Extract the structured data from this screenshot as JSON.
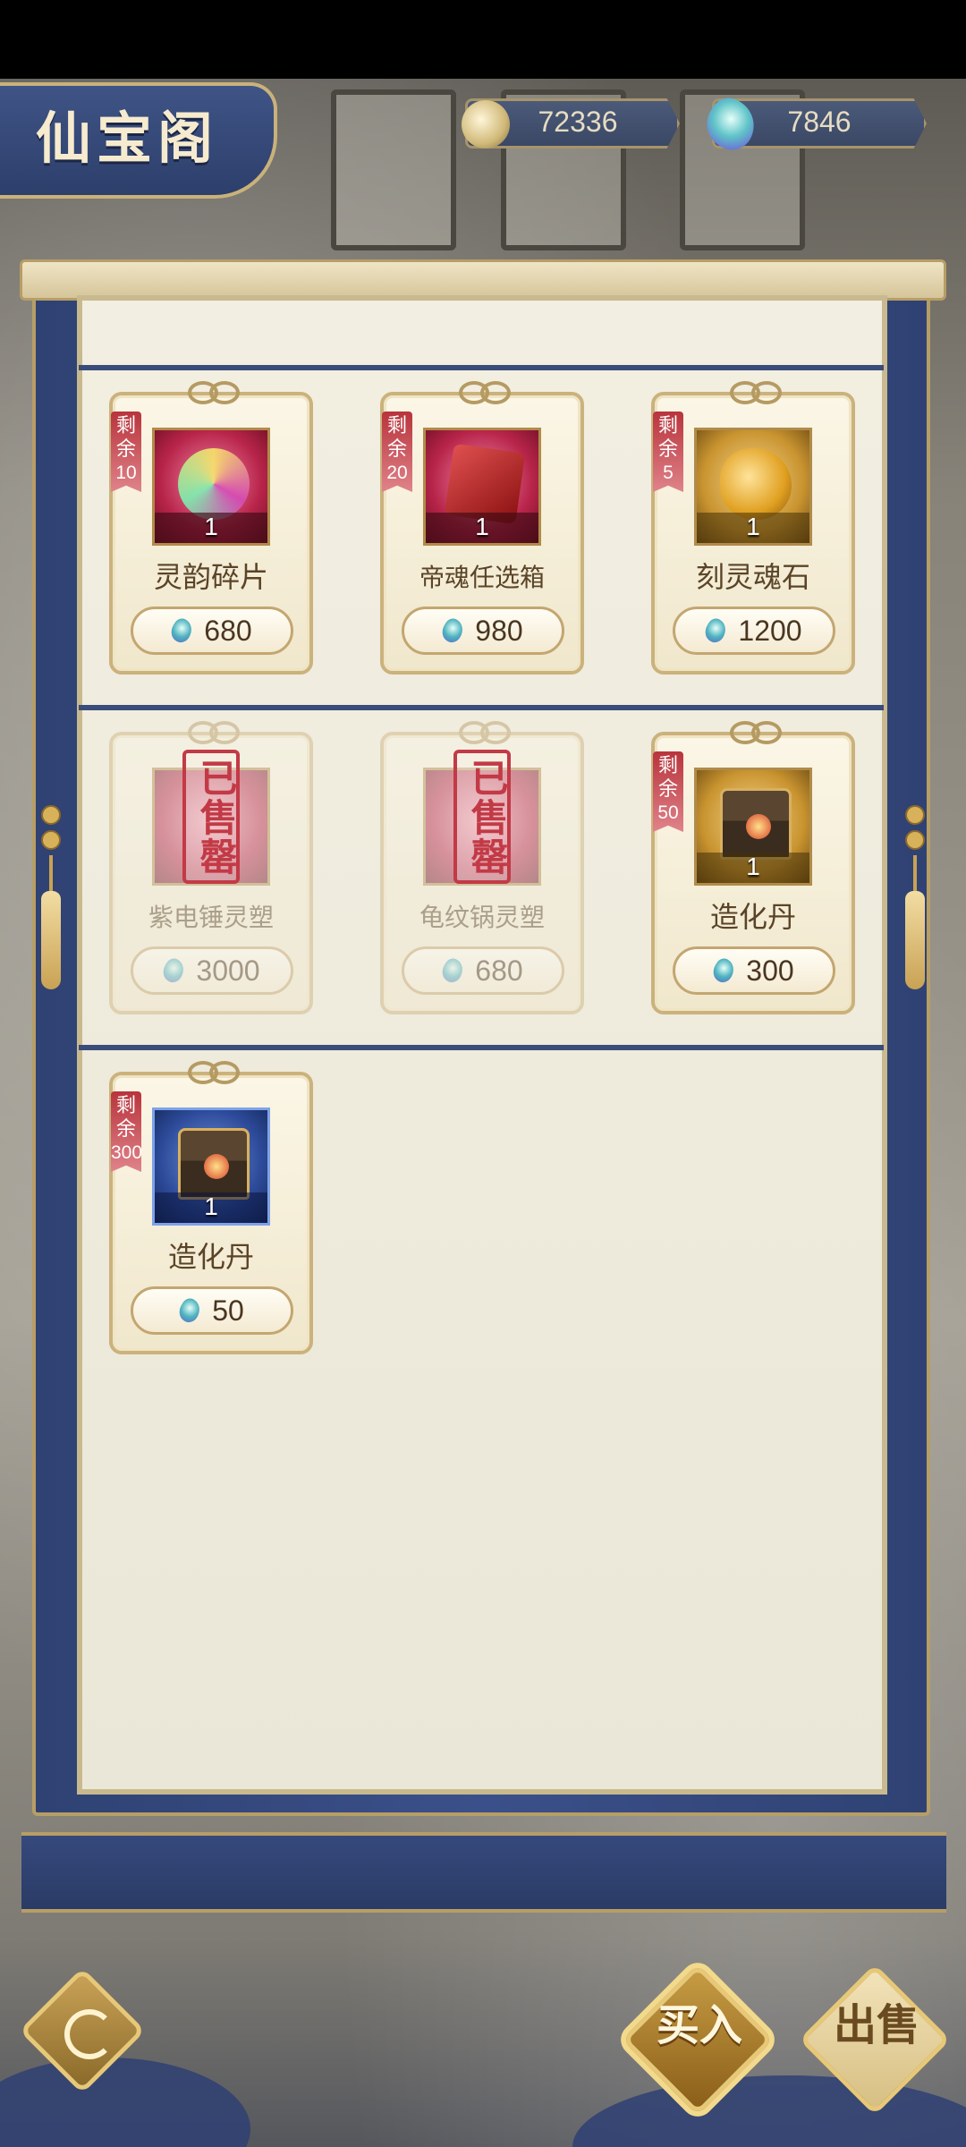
{
  "header": {
    "title": "仙宝阁",
    "currencies": [
      {
        "icon": "spirit-orb-icon",
        "value": "72336"
      },
      {
        "icon": "jade-icon",
        "value": "7846"
      }
    ]
  },
  "colors": {
    "scroll_blue": "#2f4273",
    "paper": "#f2eee1",
    "gold_border": "#cbb27c",
    "remaining_red": "#b8343c",
    "sold_stamp_red": "#c23a46"
  },
  "shop": {
    "remaining_prefix": "剩余",
    "sold_stamp": "已售罄",
    "items": [
      {
        "name": "灵韵碎片",
        "remaining": "10",
        "qty": "1",
        "price": "680",
        "art": "swirl",
        "frame": "red",
        "sold": false
      },
      {
        "name": "帝魂任选箱",
        "remaining": "20",
        "qty": "1",
        "price": "980",
        "art": "box",
        "frame": "red",
        "sold": false
      },
      {
        "name": "刻灵魂石",
        "remaining": "5",
        "qty": "1",
        "price": "1200",
        "art": "stone",
        "frame": "gold",
        "sold": false
      },
      {
        "name": "紫电锤灵塑",
        "remaining": "",
        "qty": "",
        "price": "3000",
        "art": "none",
        "frame": "red",
        "sold": true
      },
      {
        "name": "龟纹锅灵塑",
        "remaining": "",
        "qty": "",
        "price": "680",
        "art": "none",
        "frame": "red",
        "sold": true
      },
      {
        "name": "造化丹",
        "remaining": "50",
        "qty": "1",
        "price": "300",
        "art": "chest",
        "frame": "gold",
        "sold": false
      },
      {
        "name": "造化丹",
        "remaining": "300",
        "qty": "1",
        "price": "50",
        "art": "chest",
        "frame": "blue",
        "sold": false
      }
    ]
  },
  "footer": {
    "back_icon": "swirl-back-icon",
    "buy_label": "买入",
    "sell_label": "出售"
  }
}
